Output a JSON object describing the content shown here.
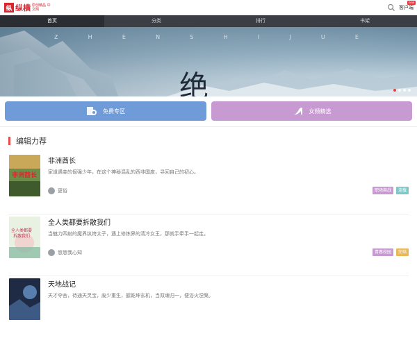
{
  "header": {
    "logo_mark": "纵",
    "logo_name": "纵横",
    "logo_sub": "原创精品 中文网",
    "client_label": "客户端",
    "client_badge": "new"
  },
  "nav": {
    "items": [
      {
        "label": "首页",
        "active": true
      },
      {
        "label": "分类",
        "active": false
      },
      {
        "label": "排行",
        "active": false
      },
      {
        "label": "书架",
        "active": false
      }
    ]
  },
  "banner": {
    "letters": [
      "Z",
      "H",
      "E",
      "N",
      "S",
      "H",
      "I",
      "J",
      "U",
      "E"
    ],
    "overlay_text": "绝",
    "slides": 4,
    "active_slide": 0
  },
  "zones": {
    "free_label": "免费专区",
    "female_label": "女频精选",
    "free_color": "#6f9bd8",
    "female_color": "#c89ad2"
  },
  "section": {
    "title": "编辑力荐",
    "accent_color": "#e54c4c"
  },
  "books": [
    {
      "title": "非洲酋长",
      "desc": "家道遇变的倔强少年，在这个神秘混乱的西非国度，寻回自己的初心。",
      "author": "更俗",
      "tags": [
        {
          "label": "职场商战",
          "color": "#c89ad2"
        },
        {
          "label": "连载",
          "color": "#7ec8c8"
        }
      ]
    },
    {
      "title": "全人类都要拆散我们",
      "desc": "当魅力四射的魔界纨绔太子，遇上修炼界的清冷女王，那就手牵手一起走。",
      "author": "悠悠我心知",
      "tags": [
        {
          "label": "青春校园",
          "color": "#c89ad2"
        },
        {
          "label": "完结",
          "color": "#e9b857"
        }
      ]
    },
    {
      "title": "天地战记",
      "desc": "天才夺舍，待通天灵宝，废少重生，握乾坤玄机，当双魂归一，便浴火涅槃。",
      "author": "",
      "tags": []
    }
  ]
}
